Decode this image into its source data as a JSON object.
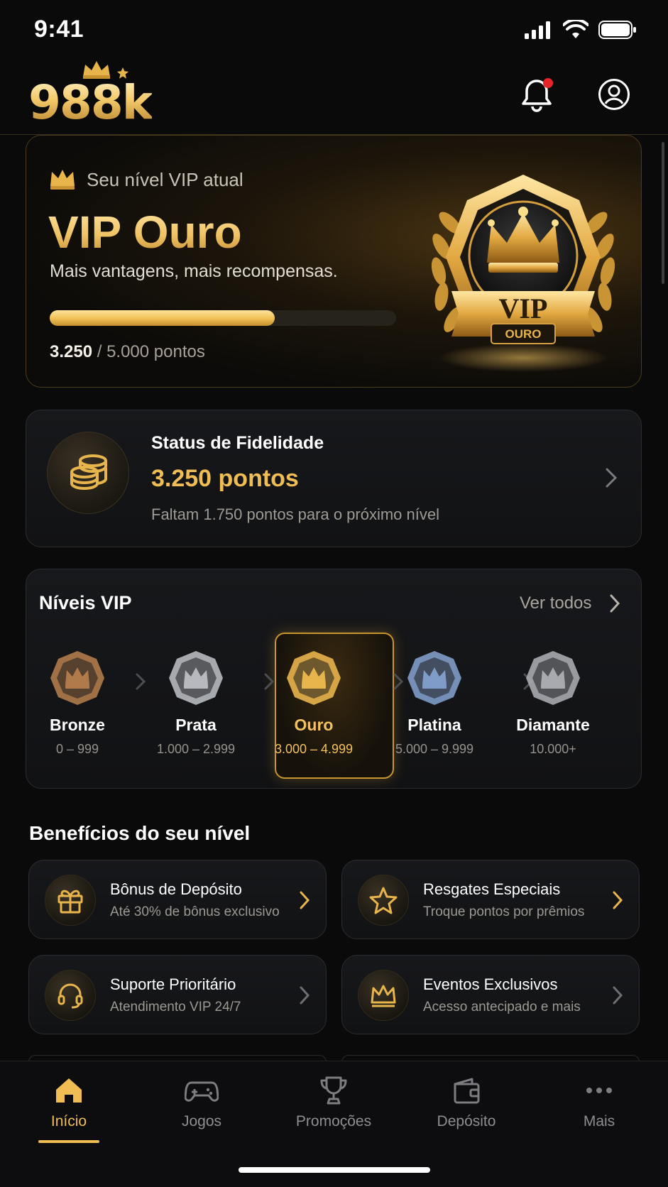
{
  "status_bar": {
    "time": "9:41"
  },
  "header": {
    "logo_text": "988k"
  },
  "vip_card": {
    "label": "Seu nível VIP atual",
    "level_name": "VIP Ouro",
    "tagline": "Mais vantagens, mais recompensas.",
    "progress_fraction": 0.65,
    "points_current": "3.250",
    "points_total": "/ 5.000 pontos",
    "badge_title": "VIP",
    "badge_subtitle": "OURO"
  },
  "loyalty": {
    "title": "Status de Fidelidade",
    "points": "3.250 pontos",
    "note": "Faltam 1.750 pontos para o próximo nível"
  },
  "levels": {
    "title": "Níveis VIP",
    "see_all": "Ver todos",
    "items": [
      {
        "name": "Bronze",
        "range": "0 – 999",
        "color": "#b07a4a"
      },
      {
        "name": "Prata",
        "range": "1.000 – 2.999",
        "color": "#b7b9bf"
      },
      {
        "name": "Ouro",
        "range": "3.000 – 4.999",
        "color": "#e8b44c",
        "active": true
      },
      {
        "name": "Platina",
        "range": "5.000 – 9.999",
        "color": "#7f9cc9"
      },
      {
        "name": "Diamante",
        "range": "10.000+",
        "color": "#a8aab0"
      }
    ]
  },
  "benefits": {
    "title": "Benefícios do seu nível",
    "items": [
      {
        "title": "Bônus de Depósito",
        "subtitle": "Até 30% de bônus exclusivo",
        "icon": "gift-icon"
      },
      {
        "title": "Resgates Especiais",
        "subtitle": "Troque pontos por prêmios",
        "icon": "star-icon"
      },
      {
        "title": "Suporte Prioritário",
        "subtitle": "Atendimento VIP 24/7",
        "icon": "headset-icon"
      },
      {
        "title": "Eventos Exclusivos",
        "subtitle": "Acesso antecipado e mais",
        "icon": "crown-icon"
      }
    ]
  },
  "nav": {
    "items": [
      {
        "label": "Início",
        "icon": "home-icon",
        "active": true
      },
      {
        "label": "Jogos",
        "icon": "gamepad-icon"
      },
      {
        "label": "Promoções",
        "icon": "trophy-icon"
      },
      {
        "label": "Depósito",
        "icon": "wallet-icon"
      },
      {
        "label": "Mais",
        "icon": "more-icon"
      }
    ]
  },
  "colors": {
    "accent": "#f0bd55",
    "background": "#0a0a0b",
    "notification_dot": "#e5252a"
  }
}
